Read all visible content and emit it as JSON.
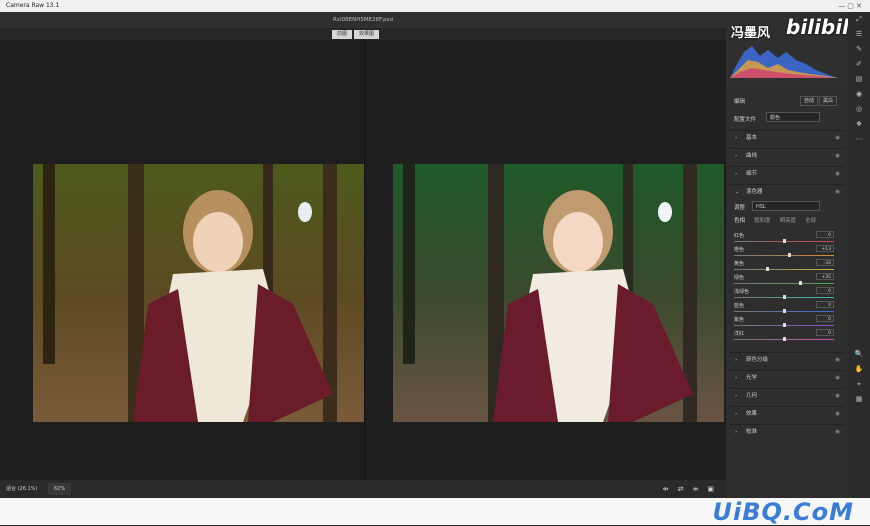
{
  "window": {
    "app_title": "Camera Raw 13.1",
    "controls": "—  ▢  ✕"
  },
  "file": {
    "name": "Rxl08ENH5ME28F.psd"
  },
  "view_tabs": [
    "前图",
    "效果图"
  ],
  "bottom": {
    "zoom_label": "适合 (26.1%)",
    "zoom_pct": "62%",
    "icons": [
      "⇹",
      "⇄",
      "⇻",
      "▣"
    ]
  },
  "watermark": {
    "name": "冯墨风",
    "site": "bilibili"
  },
  "footer": {
    "brand": "UiBQ.CoM"
  },
  "panel": {
    "title": "编辑",
    "auto_btn": "自动",
    "bw_btn": "黑白",
    "profile_label": "配置文件",
    "profile_value": "颜色",
    "sections_top": [
      {
        "label": "基本"
      },
      {
        "label": "曲线"
      },
      {
        "label": "细节"
      },
      {
        "label": "混色器"
      }
    ],
    "mixer": {
      "adjust_label": "调整",
      "adjust_value": "HSL",
      "subtabs": [
        "色相",
        "饱和度",
        "明亮度",
        "全部"
      ],
      "sliders": [
        {
          "name": "红色",
          "value": "0",
          "pos": 0.5,
          "color": "#c44"
        },
        {
          "name": "橙色",
          "value": "+13",
          "pos": 0.56,
          "color": "#d88a3a"
        },
        {
          "name": "黄色",
          "value": "-34",
          "pos": 0.33,
          "color": "#c8b23a"
        },
        {
          "name": "绿色",
          "value": "+35",
          "pos": 0.67,
          "color": "#4aa84a"
        },
        {
          "name": "浅绿色",
          "value": "0",
          "pos": 0.5,
          "color": "#3ab8b0"
        },
        {
          "name": "蓝色",
          "value": "0",
          "pos": 0.5,
          "color": "#3a6ad8"
        },
        {
          "name": "紫色",
          "value": "0",
          "pos": 0.5,
          "color": "#8a4ad8"
        },
        {
          "name": "洋红",
          "value": "0",
          "pos": 0.5,
          "color": "#c84ab8"
        }
      ]
    },
    "sections_bottom": [
      {
        "label": "颜色分级"
      },
      {
        "label": "光学"
      },
      {
        "label": "几何"
      },
      {
        "label": "效果"
      },
      {
        "label": "校准"
      }
    ],
    "chevron": "›",
    "eye": "◉"
  },
  "toolstrip": [
    "⤢",
    "☰",
    "✎",
    "✐",
    "▤",
    "◉",
    "◎",
    "❖",
    "⋯",
    "🔍",
    "✋",
    "⌖",
    "▦"
  ]
}
